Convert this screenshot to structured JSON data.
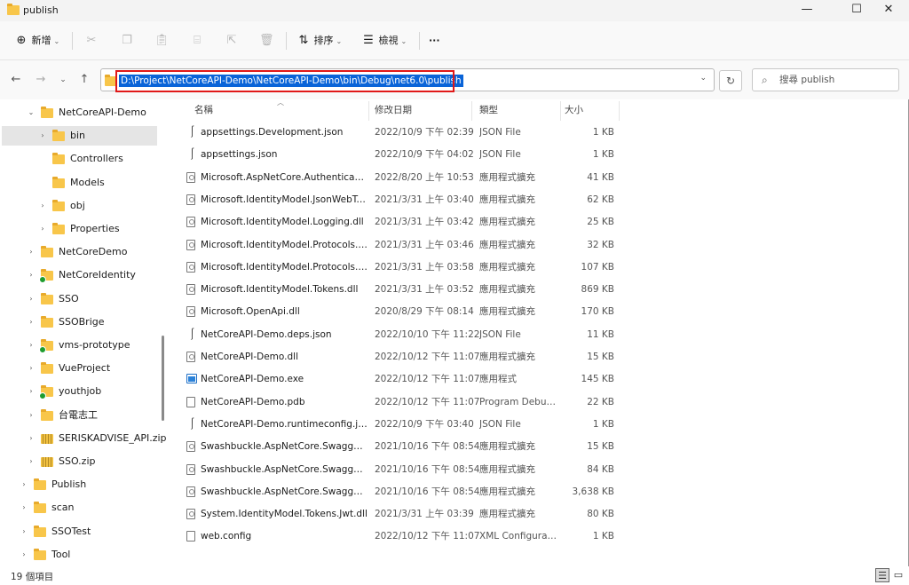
{
  "window": {
    "title": "publish",
    "minimize_glyph": "—",
    "maximize_glyph": "☐",
    "close_glyph": "✕"
  },
  "toolbar": {
    "new_label": "新增",
    "new_icon": "add-circle-icon",
    "sort_label": "排序",
    "view_label": "檢視",
    "more_glyph": "···"
  },
  "address": {
    "path": "D:\\Project\\NetCoreAPI-Demo\\NetCoreAPI-Demo\\bin\\Debug\\net6.0\\publish",
    "search_placeholder": "搜尋 publish"
  },
  "nav": {
    "items": [
      {
        "label": "NetCoreAPI-Demo",
        "expander": "⌄",
        "icon": "folder-icon"
      },
      {
        "label": "bin",
        "expander": "›",
        "icon": "folder-icon",
        "selected": true
      },
      {
        "label": "Controllers",
        "expander": "",
        "icon": "folder-icon"
      },
      {
        "label": "Models",
        "expander": "",
        "icon": "folder-icon"
      },
      {
        "label": "obj",
        "expander": "›",
        "icon": "folder-icon"
      },
      {
        "label": "Properties",
        "expander": "›",
        "icon": "folder-icon"
      },
      {
        "label": "NetCoreDemo",
        "expander": "›",
        "icon": "folder-icon"
      },
      {
        "label": "NetCoreIdentity",
        "expander": "›",
        "icon": "folder-synced-icon"
      },
      {
        "label": "SSO",
        "expander": "›",
        "icon": "folder-icon"
      },
      {
        "label": "SSOBrige",
        "expander": "›",
        "icon": "folder-icon"
      },
      {
        "label": "vms-prototype",
        "expander": "›",
        "icon": "folder-synced-icon"
      },
      {
        "label": "VueProject",
        "expander": "›",
        "icon": "folder-icon"
      },
      {
        "label": "youthjob",
        "expander": "›",
        "icon": "folder-synced-icon"
      },
      {
        "label": "台電志工",
        "expander": "›",
        "icon": "folder-icon"
      },
      {
        "label": "SERISKADVISE_API.zip",
        "expander": "›",
        "icon": "zip-folder-icon"
      },
      {
        "label": "SSO.zip",
        "expander": "›",
        "icon": "zip-folder-icon"
      },
      {
        "label": "Publish",
        "expander": "›",
        "icon": "folder-icon"
      },
      {
        "label": "scan",
        "expander": "›",
        "icon": "folder-icon"
      },
      {
        "label": "SSOTest",
        "expander": "›",
        "icon": "folder-icon"
      },
      {
        "label": "Tool",
        "expander": "›",
        "icon": "folder-icon"
      }
    ]
  },
  "columns": {
    "name": "名稱",
    "date": "修改日期",
    "type": "類型",
    "size": "大小"
  },
  "files": [
    {
      "name": "appsettings.Development.json",
      "date": "2022/10/9 下午 02:39",
      "type": "JSON File",
      "size": "1 KB",
      "icon": "json"
    },
    {
      "name": "appsettings.json",
      "date": "2022/10/9 下午 04:02",
      "type": "JSON File",
      "size": "1 KB",
      "icon": "json"
    },
    {
      "name": "Microsoft.AspNetCore.Authentication....",
      "date": "2022/8/20 上午 10:53",
      "type": "應用程式擴充",
      "size": "41 KB",
      "icon": "dll"
    },
    {
      "name": "Microsoft.IdentityModel.JsonWebTok...",
      "date": "2021/3/31 上午 03:40",
      "type": "應用程式擴充",
      "size": "62 KB",
      "icon": "dll"
    },
    {
      "name": "Microsoft.IdentityModel.Logging.dll",
      "date": "2021/3/31 上午 03:42",
      "type": "應用程式擴充",
      "size": "25 KB",
      "icon": "dll"
    },
    {
      "name": "Microsoft.IdentityModel.Protocols.dll",
      "date": "2021/3/31 上午 03:46",
      "type": "應用程式擴充",
      "size": "32 KB",
      "icon": "dll"
    },
    {
      "name": "Microsoft.IdentityModel.Protocols.Op...",
      "date": "2021/3/31 上午 03:58",
      "type": "應用程式擴充",
      "size": "107 KB",
      "icon": "dll"
    },
    {
      "name": "Microsoft.IdentityModel.Tokens.dll",
      "date": "2021/3/31 上午 03:52",
      "type": "應用程式擴充",
      "size": "869 KB",
      "icon": "dll"
    },
    {
      "name": "Microsoft.OpenApi.dll",
      "date": "2020/8/29 下午 08:14",
      "type": "應用程式擴充",
      "size": "170 KB",
      "icon": "dll"
    },
    {
      "name": "NetCoreAPI-Demo.deps.json",
      "date": "2022/10/10 下午 11:22",
      "type": "JSON File",
      "size": "11 KB",
      "icon": "json"
    },
    {
      "name": "NetCoreAPI-Demo.dll",
      "date": "2022/10/12 下午 11:07",
      "type": "應用程式擴充",
      "size": "15 KB",
      "icon": "dll"
    },
    {
      "name": "NetCoreAPI-Demo.exe",
      "date": "2022/10/12 下午 11:07",
      "type": "應用程式",
      "size": "145 KB",
      "icon": "exe"
    },
    {
      "name": "NetCoreAPI-Demo.pdb",
      "date": "2022/10/12 下午 11:07",
      "type": "Program Debug ...",
      "size": "22 KB",
      "icon": "pdb"
    },
    {
      "name": "NetCoreAPI-Demo.runtimeconfig.json",
      "date": "2022/10/9 下午 03:40",
      "type": "JSON File",
      "size": "1 KB",
      "icon": "json"
    },
    {
      "name": "Swashbuckle.AspNetCore.Swagger.dll",
      "date": "2021/10/16 下午 08:54",
      "type": "應用程式擴充",
      "size": "15 KB",
      "icon": "dll"
    },
    {
      "name": "Swashbuckle.AspNetCore.SwaggerGe...",
      "date": "2021/10/16 下午 08:54",
      "type": "應用程式擴充",
      "size": "84 KB",
      "icon": "dll"
    },
    {
      "name": "Swashbuckle.AspNetCore.SwaggerUI.dll",
      "date": "2021/10/16 下午 08:54",
      "type": "應用程式擴充",
      "size": "3,638 KB",
      "icon": "dll"
    },
    {
      "name": "System.IdentityModel.Tokens.Jwt.dll",
      "date": "2021/3/31 上午 03:39",
      "type": "應用程式擴充",
      "size": "80 KB",
      "icon": "dll"
    },
    {
      "name": "web.config",
      "date": "2022/10/12 下午 11:07",
      "type": "XML Configurati...",
      "size": "1 KB",
      "icon": "config"
    }
  ],
  "status": {
    "count": "19 個項目"
  },
  "colors": {
    "selection": "#0a64d8",
    "highlight_box": "#e01818",
    "folder": "#f8c64a",
    "synced": "#1e9c2f"
  }
}
